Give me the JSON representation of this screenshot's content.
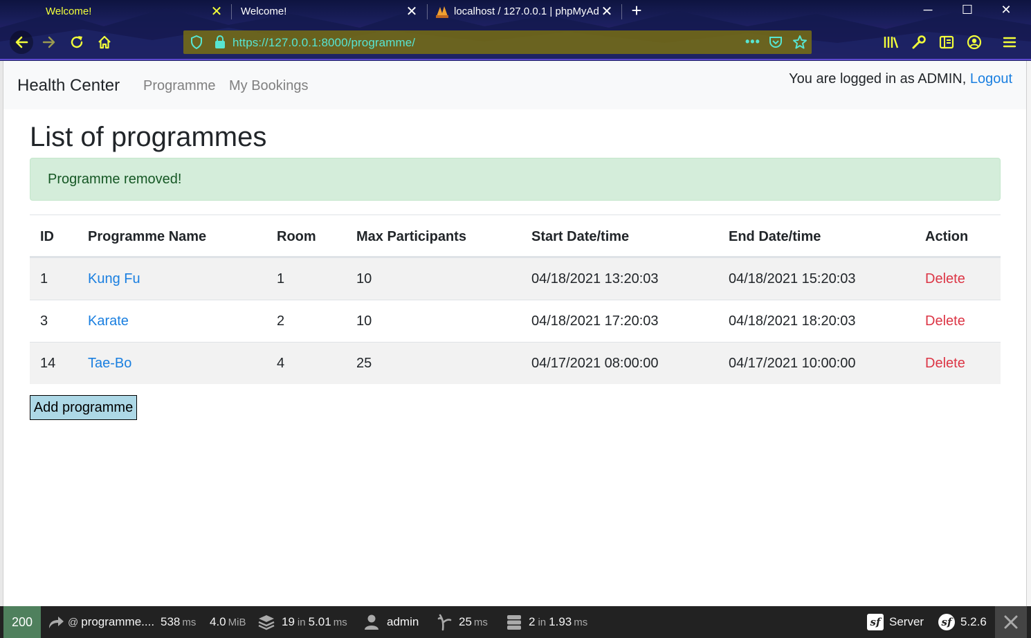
{
  "browser": {
    "tabs": [
      {
        "title": "Welcome!",
        "active": true
      },
      {
        "title": "Welcome!",
        "active": false
      },
      {
        "title": "localhost / 127.0.0.1 | phpMyAd",
        "active": false
      }
    ],
    "url": "https://127.0.0.1:8000/programme/",
    "colors": {
      "active_tab_text": "#f2ff3a",
      "url_text": "#57e5d2",
      "url_bar": "#7a7020"
    }
  },
  "navbar": {
    "brand": "Health Center",
    "links": [
      "Programme",
      "My Bookings"
    ],
    "login_prefix": "You are logged in as ADMIN,",
    "logout": "Logout"
  },
  "main": {
    "title": "List of programmes",
    "alert": "Programme removed!",
    "table": {
      "headers": [
        "ID",
        "Programme Name",
        "Room",
        "Max Participants",
        "Start Date/time",
        "End Date/time",
        "Action"
      ],
      "rows": [
        {
          "id": "1",
          "name": "Kung Fu",
          "room": "1",
          "max": "10",
          "start": "04/18/2021 13:20:03",
          "end": "04/18/2021 15:20:03",
          "action": "Delete"
        },
        {
          "id": "3",
          "name": "Karate",
          "room": "2",
          "max": "10",
          "start": "04/18/2021 17:20:03",
          "end": "04/18/2021 18:20:03",
          "action": "Delete"
        },
        {
          "id": "14",
          "name": "Tae-Bo",
          "room": "4",
          "max": "25",
          "start": "04/17/2021 08:00:00",
          "end": "04/17/2021 10:00:00",
          "action": "Delete"
        }
      ]
    },
    "add_button": "Add programme",
    "colors": {
      "link": "#1a7fe0",
      "delete": "#dc3545",
      "alert_bg": "#d4edda",
      "alert_text": "#155724",
      "button_bg": "#add8e6"
    }
  },
  "debug_bar": {
    "status": "200",
    "route": "programme....",
    "route_prefix": "@",
    "time": "538",
    "time_unit": "ms",
    "memory": "4.0",
    "memory_unit": "MiB",
    "templates": "19",
    "templates_in": "in",
    "templates_time": "5.01",
    "templates_unit": "ms",
    "user": "admin",
    "twig_time": "25",
    "twig_unit": "ms",
    "db_queries": "2",
    "db_in": "in",
    "db_time": "1.93",
    "db_unit": "ms",
    "server": "Server",
    "version": "5.2.6",
    "colors": {
      "status_bg": "#4f805d",
      "bar_bg": "#222222"
    }
  }
}
